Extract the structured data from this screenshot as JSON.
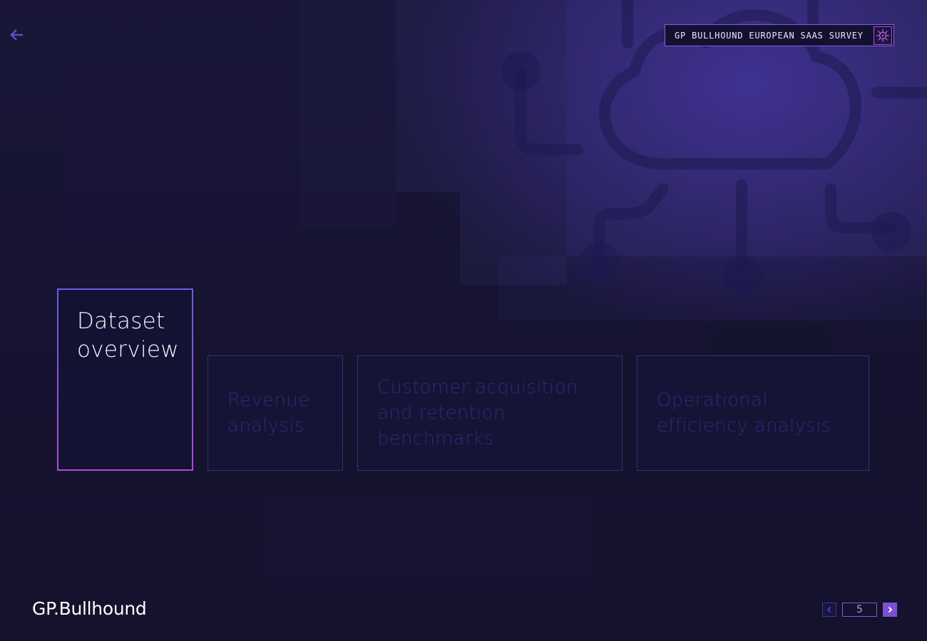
{
  "header": {
    "survey_label": "GP BULLHOUND EUROPEAN SAAS SURVEY",
    "survey_icon": "virus-icon",
    "back_icon": "arrow-left-icon"
  },
  "sections": [
    {
      "label": "Dataset overview",
      "active": true
    },
    {
      "label": "Revenue analysis",
      "active": false
    },
    {
      "label": "Customer acquisition and retention benchmarks",
      "active": false
    },
    {
      "label": "Operational efficiency analysis",
      "active": false
    }
  ],
  "footer": {
    "logo": "GP.Bullhound",
    "page_number": "5"
  },
  "colors": {
    "background": "#14132f",
    "accent_purple": "#7b52d6",
    "accent_magenta": "#b14ad6"
  }
}
